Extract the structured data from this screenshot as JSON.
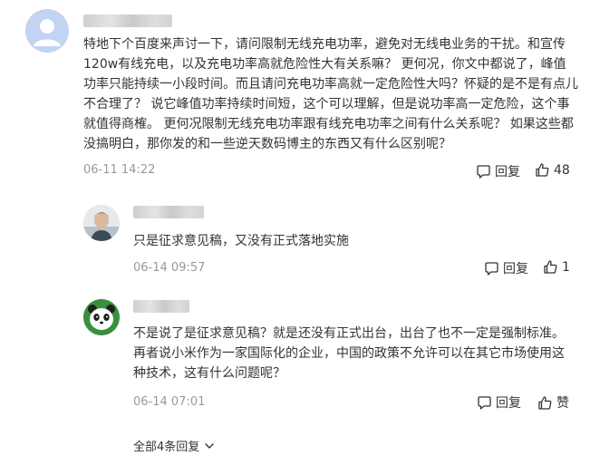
{
  "comment": {
    "text": "特地下个百度来声讨一下，请问限制无线充电功率，避免对无线电业务的干扰。和宣传120w有线充电，以及充电功率高就危险性大有关系嘛？ 更何况，你文中都说了，峰值功率只能持续一小段时间。而且请问充电功率高就一定危险性大吗？怀疑的是不是有点儿不合理了？ 说它峰值功率持续时间短，这个可以理解，但是说功率高一定危险，这个事就值得商榷。 更何况限制无线充电功率跟有线充电功率之间有什么关系呢？ 如果这些都没搞明白，那你发的和一些逆天数码博主的东西又有什么区别呢？",
    "time": "06-11 14:22",
    "reply_label": "回复",
    "likes": "48",
    "avatar_icon": "default-user-icon"
  },
  "replies": [
    {
      "text": "只是征求意见稿，又没有正式落地实施",
      "time": "06-14 09:57",
      "reply_label": "回复",
      "likes": "1",
      "avatar_icon": "person-photo-avatar"
    },
    {
      "text": "不是说了是征求意见稿？就是还没有正式出台，出台了也不一定是强制标准。再者说小米作为一家国际化的企业，中国的政策不允许可以在其它市场使用这种技术，这有什么问题呢？",
      "time": "06-14 07:01",
      "reply_label": "回复",
      "likes": "赞",
      "avatar_icon": "panda-avatar"
    }
  ],
  "expand_label": "全部4条回复",
  "colors": {
    "text": "#333333",
    "muted": "#999999",
    "avatar_blue": "#b9cdef",
    "panda_green": "#3a8f3e"
  }
}
